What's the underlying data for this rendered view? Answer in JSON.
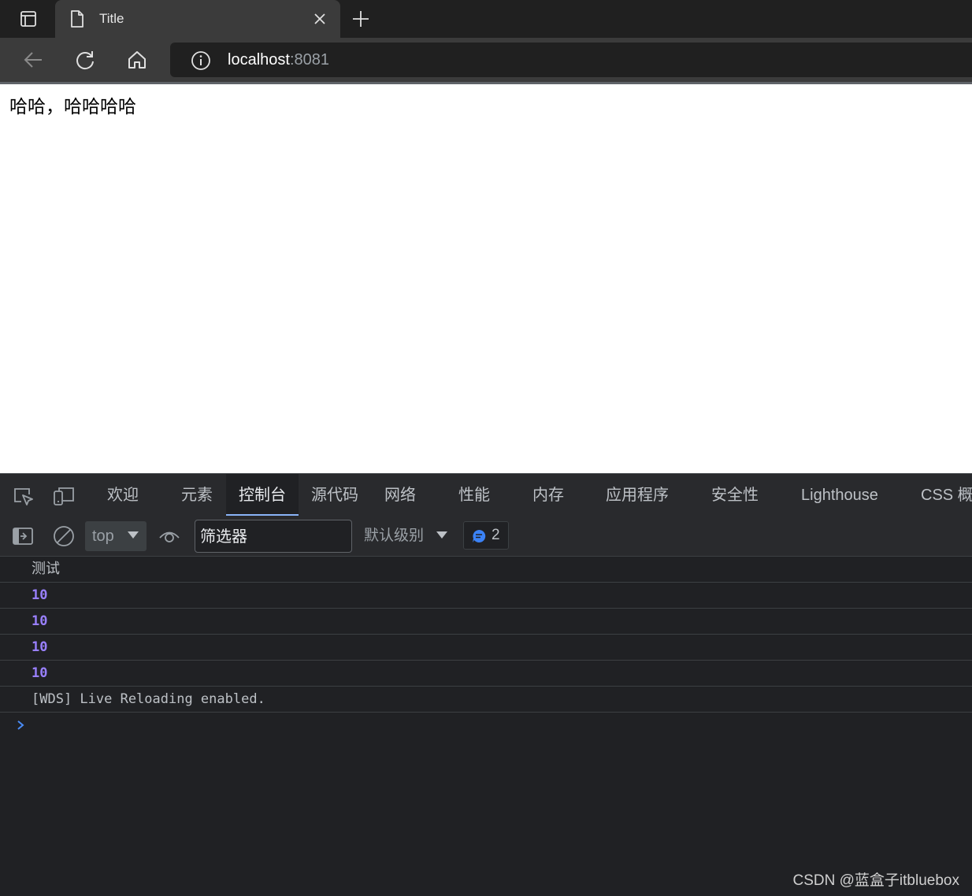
{
  "browser": {
    "tab": {
      "title": "Title"
    },
    "address": {
      "host": "localhost",
      "port": ":8081"
    }
  },
  "page": {
    "text": "哈哈，哈哈哈哈"
  },
  "devtools": {
    "tabs": [
      {
        "label": "欢迎"
      },
      {
        "label": "元素"
      },
      {
        "label": "控制台"
      },
      {
        "label": "源代码"
      },
      {
        "label": "网络"
      },
      {
        "label": "性能"
      },
      {
        "label": "内存"
      },
      {
        "label": "应用程序"
      },
      {
        "label": "安全性"
      },
      {
        "label": "Lighthouse"
      },
      {
        "label": "CSS 概述"
      }
    ],
    "active_tab": "控制台",
    "console_bar": {
      "context": "top",
      "filter_placeholder": "筛选器",
      "levels": "默认级别",
      "message_count": "2"
    },
    "console_rows": [
      {
        "text": "测试",
        "kind": "text"
      },
      {
        "text": "10",
        "kind": "number"
      },
      {
        "text": "10",
        "kind": "number"
      },
      {
        "text": "10",
        "kind": "number"
      },
      {
        "text": "10",
        "kind": "number"
      },
      {
        "text": "[WDS] Live Reloading enabled.",
        "kind": "log"
      }
    ]
  },
  "watermark": "CSDN @蓝盒子itbluebox",
  "colors": {
    "accent": "#8ab4f8",
    "number": "#9980ff",
    "devtools_bg": "#202124",
    "chrome_bg": "#3b3b3b"
  }
}
